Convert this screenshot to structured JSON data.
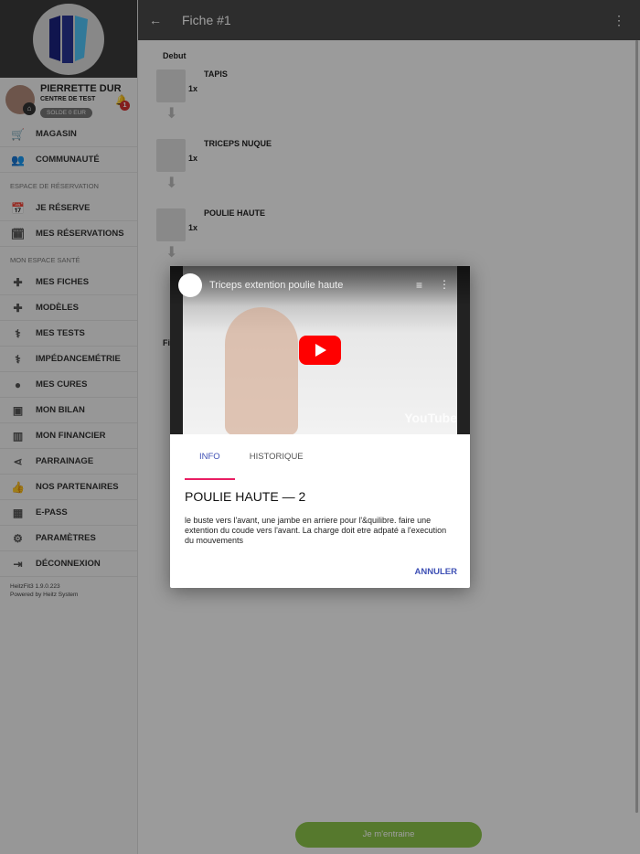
{
  "sidebar": {
    "user": {
      "name": "PIERRETTE DUR",
      "centre": "CENTRE DE TEST",
      "solde": "SOLDE 0 EUR",
      "notifications": "1"
    },
    "items": [
      {
        "label": "MAGASIN",
        "icon": "cart-icon",
        "glyph": "🛒"
      },
      {
        "label": "COMMUNAUTÉ",
        "icon": "people-icon",
        "glyph": "👥"
      }
    ],
    "section1": "ESPACE DE RÉSERVATION",
    "items2": [
      {
        "label": "JE RÉSERVE",
        "icon": "calendar-icon",
        "glyph": "📅"
      },
      {
        "label": "MES RÉSERVATIONS",
        "icon": "calendar-check-icon",
        "glyph": "🗓"
      }
    ],
    "section2": "MON ESPACE SANTÉ",
    "items3": [
      {
        "label": "MES FICHES",
        "icon": "dumbbell-icon",
        "glyph": "✚"
      },
      {
        "label": "MODÈLES",
        "icon": "dumbbell-icon",
        "glyph": "✚"
      },
      {
        "label": "MES TESTS",
        "icon": "stethoscope-icon",
        "glyph": "⚕"
      },
      {
        "label": "IMPÉDANCEMÉTRIE",
        "icon": "stethoscope-icon",
        "glyph": "⚕"
      },
      {
        "label": "MES CURES",
        "icon": "apple-icon",
        "glyph": "●"
      },
      {
        "label": "MON BILAN",
        "icon": "clipboard-icon",
        "glyph": "▣"
      },
      {
        "label": "MON FINANCIER",
        "icon": "barcode-icon",
        "glyph": "▥"
      },
      {
        "label": "PARRAINAGE",
        "icon": "share-icon",
        "glyph": "⋖"
      },
      {
        "label": "NOS PARTENAIRES",
        "icon": "thumb-up-icon",
        "glyph": "👍"
      },
      {
        "label": "E-PASS",
        "icon": "qr-code-icon",
        "glyph": "▦"
      },
      {
        "label": "PARAMÈTRES",
        "icon": "gear-icon",
        "glyph": "⚙"
      },
      {
        "label": "DÉCONNEXION",
        "icon": "exit-icon",
        "glyph": "⇥"
      }
    ],
    "version": "HeitzFit3 1.9.0.223",
    "powered": "Powered by Heitz System"
  },
  "header": {
    "title": "Fiche #1"
  },
  "main": {
    "start": "Debut",
    "exercises": [
      {
        "name": "TAPIS",
        "count": "1x"
      },
      {
        "name": "TRICEPS NUQUE",
        "count": "1x"
      },
      {
        "name": "POULIE HAUTE",
        "count": "1x"
      }
    ],
    "end": "Fi",
    "train_button": "Je m'entraine"
  },
  "dialog": {
    "video_title": "Triceps extention poulie haute",
    "video_brand": "YouTube",
    "tabs": [
      "INFO",
      "HISTORIQUE"
    ],
    "title": "POULIE HAUTE — 2",
    "description": "le buste vers l'avant, une jambe en arriere pour l'&quilibre. faire une extention du coude vers l'avant. La charge doit etre adpaté a l'execution du mouvements",
    "cancel": "ANNULER"
  },
  "colors": {
    "accent": "#3f51b5",
    "tab_indicator": "#e91e63",
    "train": "#8bc34a",
    "badge": "#d32f2f"
  }
}
